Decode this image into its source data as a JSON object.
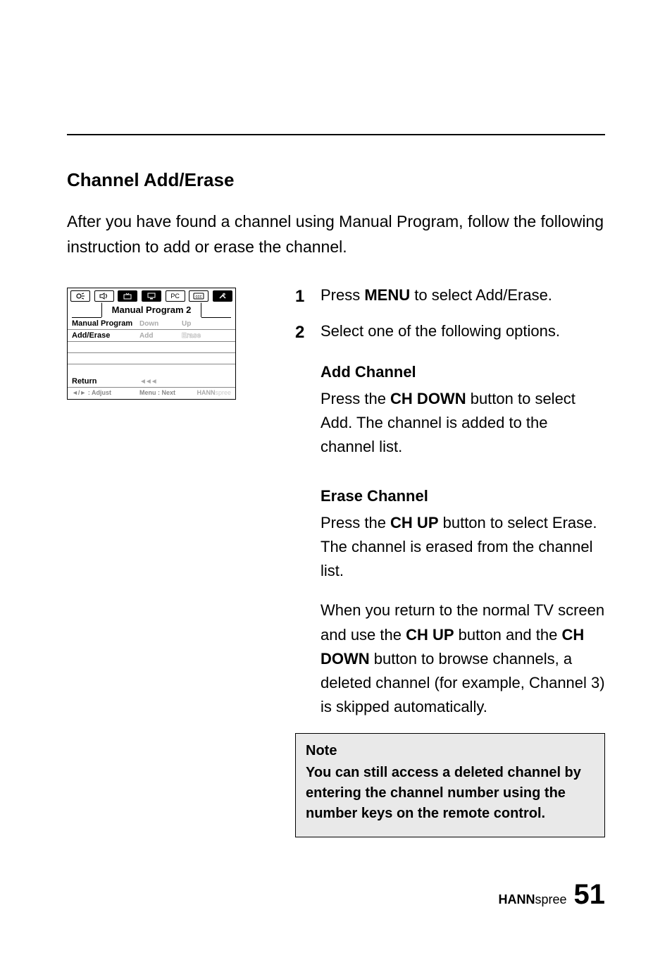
{
  "section_title": "Channel Add/Erase",
  "intro": "After you have found a channel using Manual Program, follow the following instruction to add or erase the channel.",
  "osd": {
    "icons": [
      "brightness",
      "sound",
      "tv",
      "monitor",
      "pc",
      "cc",
      "tools"
    ],
    "pc_label": "PC",
    "title": "Manual Program   2",
    "rows": [
      {
        "label": "Manual Program",
        "v1": "Down",
        "v2": "Up"
      },
      {
        "label": "Add/Erase",
        "v1": "Add",
        "v2": "Erase"
      }
    ],
    "return_label": "Return",
    "return_arrows": "◄◄◄",
    "foot_adjust": "◄/► : Adjust",
    "foot_menu": "Menu : Next",
    "brand1": "HANN",
    "brand2": "spree"
  },
  "steps": [
    {
      "num": "1",
      "pre": "Press ",
      "bold": "MENU",
      "post": " to select Add/Erase."
    },
    {
      "num": "2",
      "pre": "",
      "bold": "",
      "post": "Select one of the following options."
    }
  ],
  "add": {
    "heading": "Add Channel",
    "p1a": "Press the ",
    "p1b": "CH DOWN",
    "p1c": " button to select Add. The channel is added to the channel list."
  },
  "erase": {
    "heading": "Erase Channel",
    "p1a": "Press the ",
    "p1b": "CH UP",
    "p1c": " button to select Erase. The channel is erased from the channel list.",
    "p2a": "When you return to the normal TV screen and use the ",
    "p2b": "CH UP",
    "p2c": " button and the ",
    "p2d": "CH DOWN",
    "p2e": " button to browse channels, a deleted channel (for example, Channel 3) is skipped automatically."
  },
  "note": {
    "title": "Note",
    "body": "You can still access a deleted channel by entering the channel number using the number keys on the remote control."
  },
  "footer": {
    "brand1": "HANN",
    "brand2": "spree",
    "page": "51"
  }
}
